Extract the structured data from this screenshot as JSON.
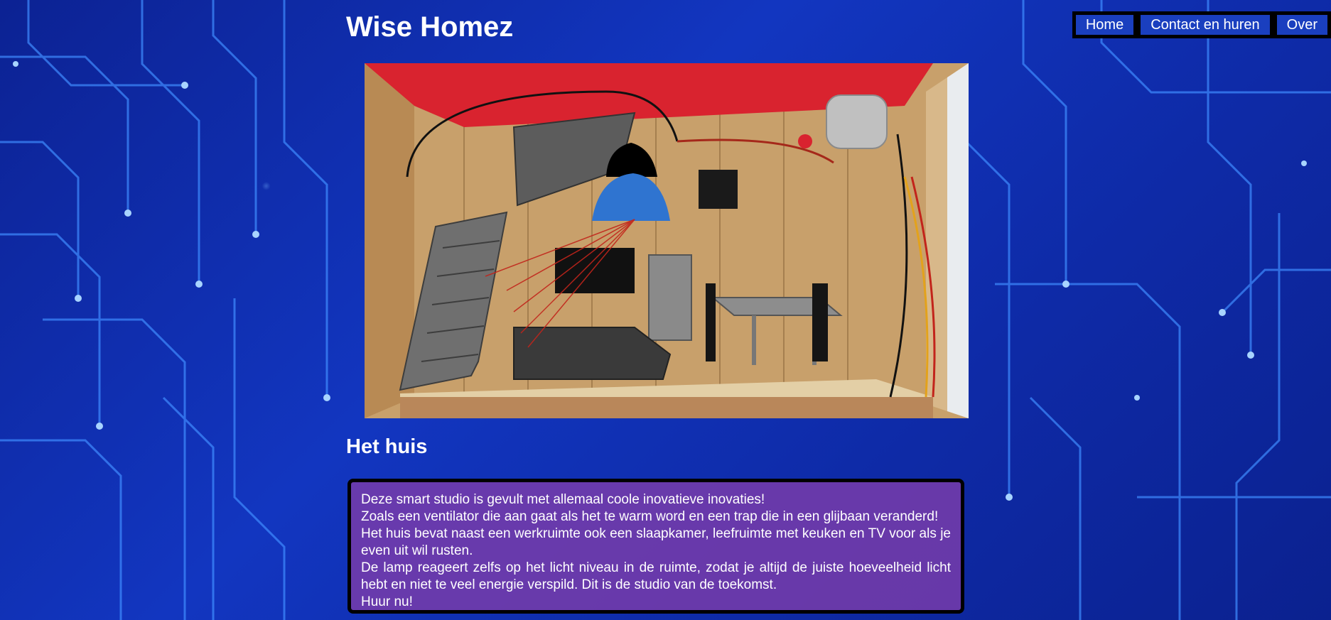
{
  "site": {
    "title": "Wise Homez"
  },
  "nav": {
    "items": [
      {
        "label": "Home"
      },
      {
        "label": "Contact en huren"
      },
      {
        "label": "Over"
      }
    ]
  },
  "section": {
    "title": "Het huis",
    "lines": [
      "Deze smart studio is gevult met allemaal coole inovatieve inovaties!",
      "Zoals een ventilator die aan gaat als het te warm word en een trap die in een glijbaan veranderd!",
      "Het huis bevat naast een werkruimte ook een slaapkamer, leefruimte met keuken en TV voor als je even uit wil rusten.",
      "De lamp reageert zelfs op het licht niveau in de ruimte, zodat je altijd de juiste hoeveelheid licht hebt en niet te veel energie verspild. Dit is de studio van de toekomst.",
      "Huur nu!"
    ]
  },
  "colors": {
    "background": "#0f2aa8",
    "nav_button": "#1a3fbf",
    "description_box": "#783caa",
    "text": "#ffffff"
  }
}
